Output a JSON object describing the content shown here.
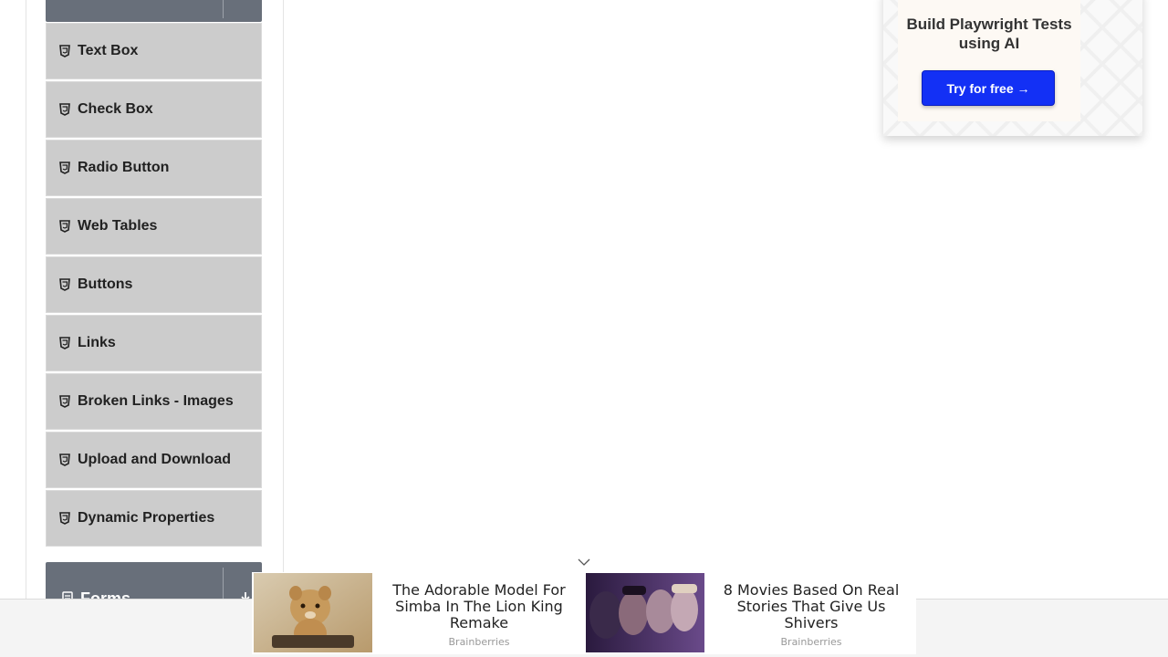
{
  "sidebar": {
    "items": [
      {
        "label": "Text Box",
        "icon": "html5-icon"
      },
      {
        "label": "Check Box",
        "icon": "html5-icon"
      },
      {
        "label": "Radio Button",
        "icon": "html5-icon"
      },
      {
        "label": "Web Tables",
        "icon": "html5-icon"
      },
      {
        "label": "Buttons",
        "icon": "html5-icon"
      },
      {
        "label": "Links",
        "icon": "html5-icon"
      },
      {
        "label": "Broken Links - Images",
        "icon": "html5-icon"
      },
      {
        "label": "Upload and Download",
        "icon": "html5-icon"
      },
      {
        "label": "Dynamic Properties",
        "icon": "html5-icon"
      }
    ],
    "next_group": {
      "title": "Forms",
      "icon": "document-icon"
    }
  },
  "side_ad": {
    "headline": "Build Playwright Tests using AI",
    "button_label": "Try for free →",
    "button_color": "#1330f5"
  },
  "bottom_ads": [
    {
      "headline": "The Adorable Model For Simba In The Lion King Remake",
      "source": "Brainberries"
    },
    {
      "headline": "8 Movies Based On Real Stories That Give Us Shivers",
      "source": "Brainberries"
    }
  ],
  "colors": {
    "menu_bg": "#cccccc",
    "group_header_bg": "#686f7a"
  }
}
